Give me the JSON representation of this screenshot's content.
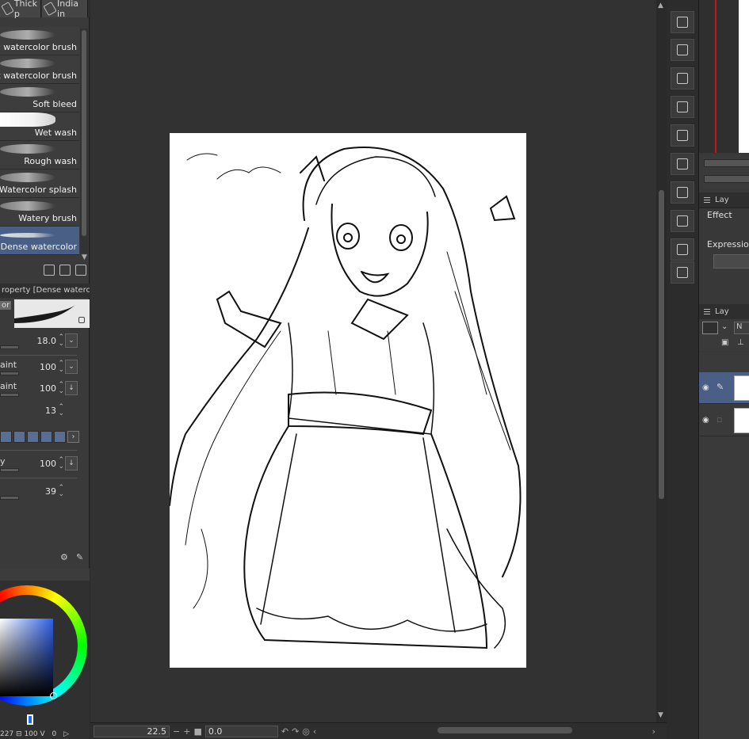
{
  "tool_tabs": [
    {
      "label": "Thick p"
    },
    {
      "label": "India in"
    }
  ],
  "brushes": [
    {
      "label": "und watercolor brush"
    },
    {
      "label": "Flat watercolor brush"
    },
    {
      "label": "Soft bleed"
    },
    {
      "label": "Wet wash"
    },
    {
      "label": "Rough wash"
    },
    {
      "label": "Watercolor splash"
    },
    {
      "label": "Watery brush"
    },
    {
      "label": "Dense watercolor",
      "selected": true
    }
  ],
  "tool_property": {
    "title": "roperty [Dense watercolor",
    "preview_tab": "or",
    "rows": [
      {
        "label": "",
        "value": "18.0"
      },
      {
        "label": "aint",
        "value": "100"
      },
      {
        "label": "aint",
        "value": "100"
      },
      {
        "label": "",
        "value": "13"
      },
      {
        "label": "y",
        "value": "100"
      },
      {
        "label": "",
        "value": "39"
      }
    ]
  },
  "color": {
    "status_text": "227 ⊟ 100 V",
    "status_value": "0",
    "accent": "#3060e8"
  },
  "canvas": {
    "zoom": "22.5",
    "rotation": "0.0"
  },
  "right_panel": {
    "layer_property_tab": "Lay",
    "effect_label": "Effect",
    "expression_label": "Expression",
    "layer_tab": "Lay",
    "blend_mode": "N"
  },
  "icons": {
    "strip": [
      "import-icon",
      "grid-icon",
      "close-x-icon",
      "import-icon",
      "window-icon",
      "resize-icon",
      "figure-icon",
      "grid-icon",
      "star-icon",
      "asset-icon"
    ]
  }
}
